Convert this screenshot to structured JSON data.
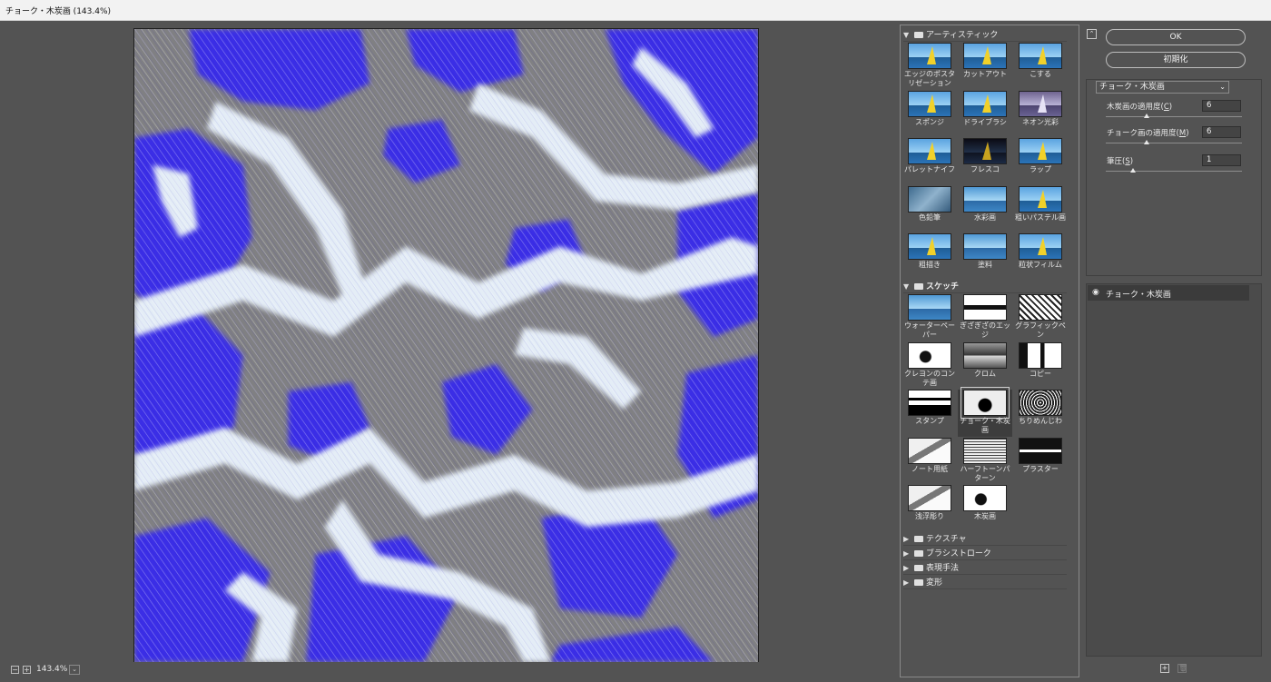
{
  "window": {
    "title": "チョーク・木炭画 (143.4%)"
  },
  "status": {
    "minus": "−",
    "plus": "+",
    "zoom": "143.4%",
    "zoom_dropdown": "⌄"
  },
  "gallery": {
    "categories": [
      {
        "label": "アーティスティック",
        "expanded": true,
        "items": [
          "エッジのポスタリゼーション",
          "カットアウト",
          "こする",
          "スポンジ",
          "ドライブラシ",
          "ネオン光彩",
          "パレットナイフ",
          "フレスコ",
          "ラップ",
          "色鉛筆",
          "水彩画",
          "粗いパステル画",
          "粗描き",
          "塗料",
          "粒状フィルム"
        ]
      },
      {
        "label": "スケッチ",
        "expanded": true,
        "items": [
          "ウォーターペーパー",
          "ぎざぎざのエッジ",
          "グラフィックペン",
          "クレヨンのコンテ画",
          "クロム",
          "コピー",
          "スタンプ",
          "チョーク・木炭画",
          "ちりめんじわ",
          "ノート用紙",
          "ハーフトーンパターン",
          "プラスター",
          "浅浮彫り",
          "木炭画"
        ],
        "selected": "チョーク・木炭画"
      },
      {
        "label": "テクスチャ",
        "expanded": false
      },
      {
        "label": "ブラシストローク",
        "expanded": false
      },
      {
        "label": "表現手法",
        "expanded": false
      },
      {
        "label": "変形",
        "expanded": false
      }
    ]
  },
  "buttons": {
    "ok": "OK",
    "reset": "初期化",
    "collapse": "⌃"
  },
  "settings": {
    "filter": "チョーク・木炭画",
    "filter_arrow": "⌄",
    "params": [
      {
        "label": "木炭画の適用度",
        "key": "C",
        "value": "6",
        "level": 0.3
      },
      {
        "label": "チョーク画の適用度",
        "key": "M",
        "value": "6",
        "level": 0.3
      },
      {
        "label": "筆圧",
        "key": "S",
        "value": "1",
        "level": 0.2
      }
    ]
  },
  "layers": {
    "items": [
      {
        "name": "チョーク・木炭画",
        "visible": true
      }
    ],
    "new_icon": "+",
    "delete_icon": "🗑"
  },
  "icons": {
    "eye": "eye-icon",
    "folder": "folder-icon",
    "expand": "triangle-down-icon",
    "collapse": "triangle-right-icon"
  },
  "colors": {
    "blue": "#3a2fe0",
    "gray": "#808083",
    "white": "#e6eef6",
    "panel": "#535353"
  }
}
